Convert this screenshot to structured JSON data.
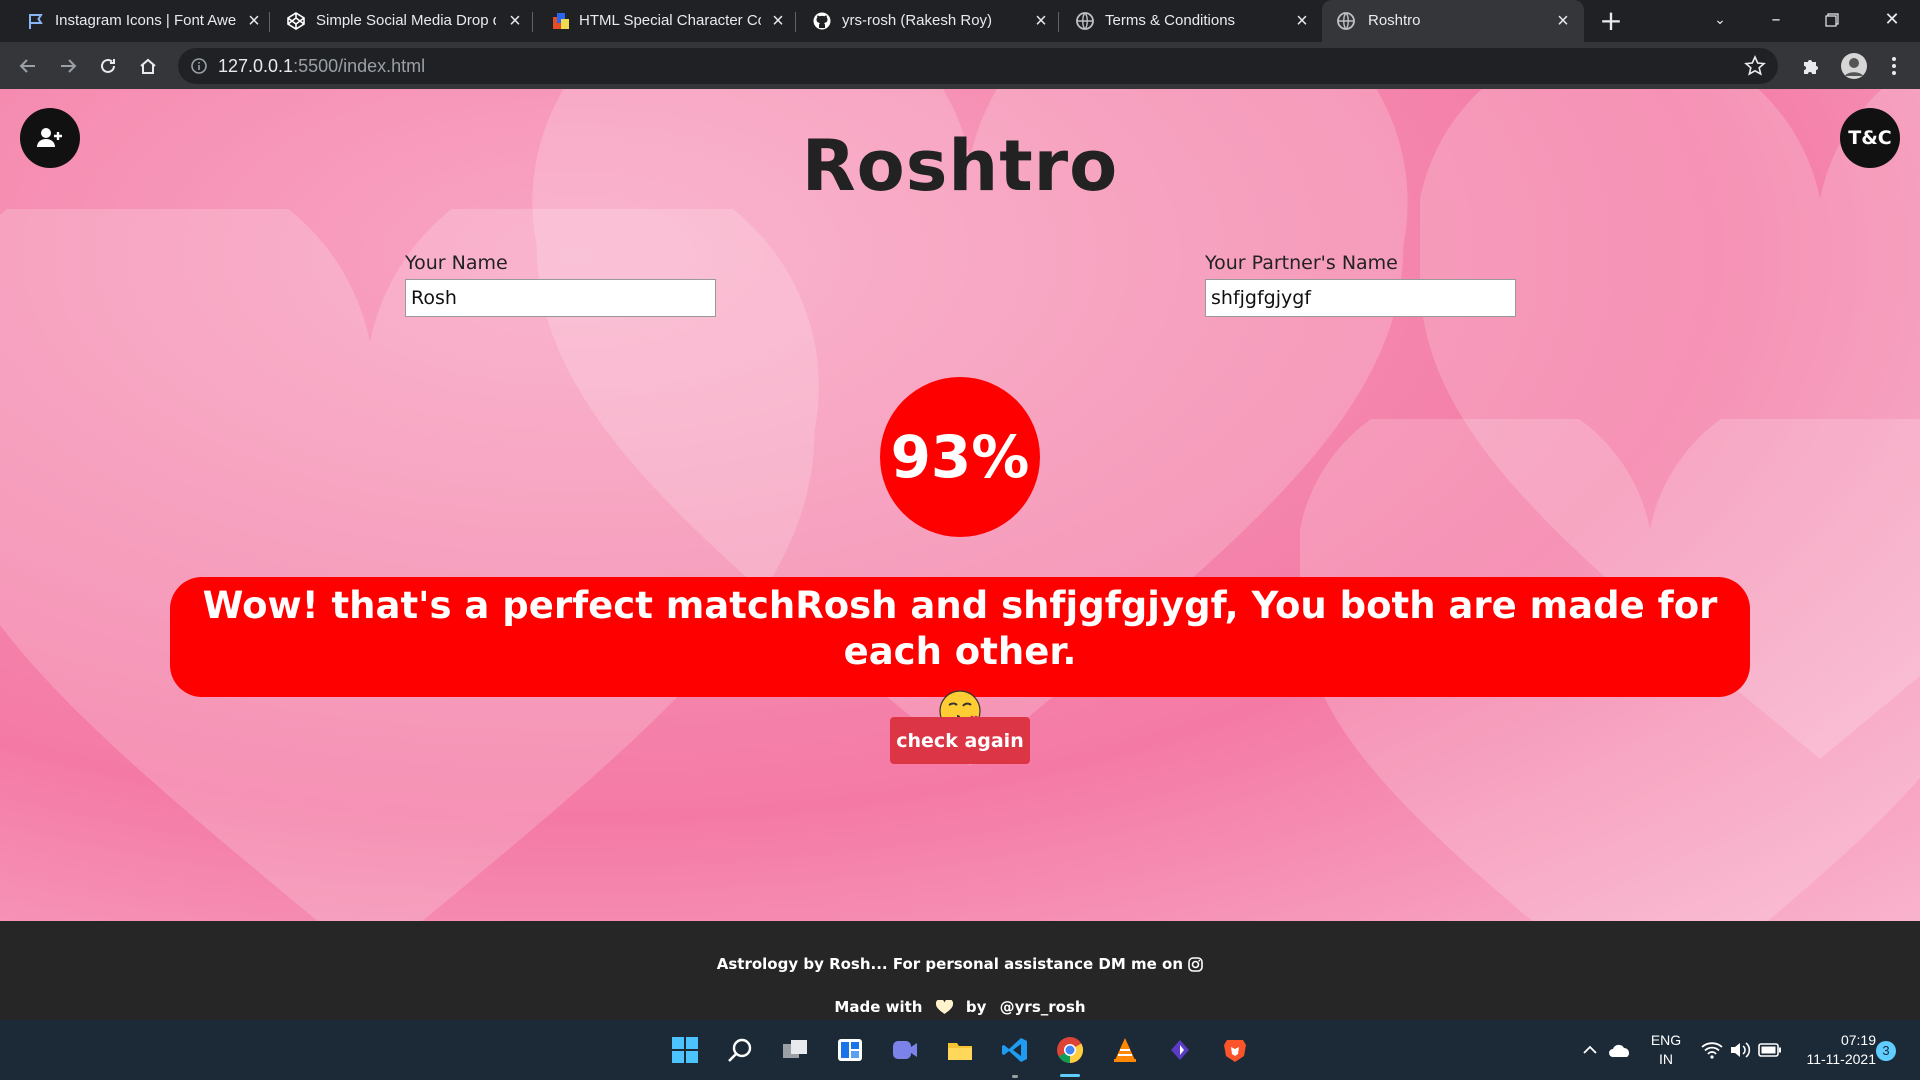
{
  "browser": {
    "tabs": [
      {
        "title": "Instagram Icons | Font Awe",
        "icon": "flag-icon"
      },
      {
        "title": "Simple Social Media Drop d",
        "icon": "codepen-icon"
      },
      {
        "title": "HTML Special Character Co",
        "icon": "html-icon"
      },
      {
        "title": "yrs-rosh (Rakesh Roy)",
        "icon": "github-icon"
      },
      {
        "title": "Terms & Conditions",
        "icon": "globe-icon"
      },
      {
        "title": "Roshtro",
        "icon": "globe-icon",
        "active": true
      }
    ],
    "url_host": "127.0.0.1",
    "url_rest": ":5500/index.html"
  },
  "page": {
    "brand": "Roshtro",
    "tc_label": "T&C",
    "your_name_label": "Your Name",
    "your_name_value": "Rosh",
    "partner_label": "Your Partner's Name",
    "partner_value": "shfjgfgjygf",
    "percent": "93%",
    "result_text": "Wow! that's a perfect matchRosh and shfjgfgjygf, You both are made for each other.",
    "result_emoji": "kissing-heart-emoji",
    "check_again": "check again"
  },
  "footer": {
    "line1": "Astrology by Rosh... For personal assistance DM me on",
    "made_with": "Made with",
    "by": "by",
    "handle": "@yrs_rosh"
  },
  "taskbar": {
    "lang_top": "ENG",
    "lang_bottom": "IN",
    "time": "07:19",
    "date": "11-11-2021",
    "notifications": "3"
  },
  "colors": {
    "accent_red": "#ff0000",
    "button_red": "#dc3545",
    "page_pink": "#f58bb0",
    "footer_bg": "#262626"
  }
}
